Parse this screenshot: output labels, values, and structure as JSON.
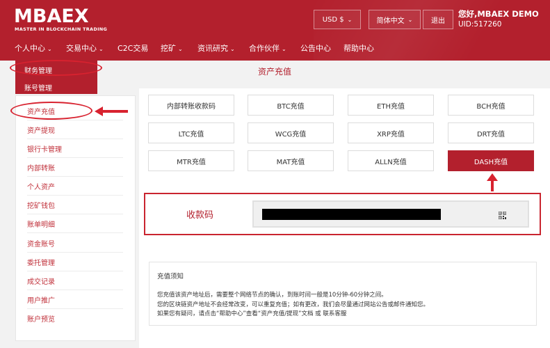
{
  "header": {
    "logo": "MBAEX",
    "logo_tagline": "MASTER IN BLOCKCHAIN TRADING",
    "currency": "USD $",
    "language": "简体中文",
    "logout": "退出",
    "greeting": "您好,MBAEX DEMO",
    "uid": "UID:517260"
  },
  "nav": {
    "items": [
      {
        "label": "个人中心",
        "has_dropdown": true
      },
      {
        "label": "交易中心",
        "has_dropdown": true
      },
      {
        "label": "C2C交易",
        "has_dropdown": false
      },
      {
        "label": "挖矿",
        "has_dropdown": true
      },
      {
        "label": "资讯研究",
        "has_dropdown": true
      },
      {
        "label": "合作伙伴",
        "has_dropdown": true
      },
      {
        "label": "公告中心",
        "has_dropdown": false
      },
      {
        "label": "帮助中心",
        "has_dropdown": false
      }
    ],
    "dropdown": [
      "财务管理",
      "账号管理"
    ]
  },
  "page_title": "资产充值",
  "sidebar": {
    "items": [
      "资产充值",
      "资产提现",
      "银行卡管理",
      "内部转账",
      "个人资产",
      "挖矿钱包",
      "账单明细",
      "资金账号",
      "委托管理",
      "成交记录",
      "用户推广",
      "账户预览"
    ],
    "active": "资产充值"
  },
  "coins": {
    "buttons": [
      "内部转账收款码",
      "BTC充值",
      "ETH充值",
      "BCH充值",
      "LTC充值",
      "WCG充值",
      "XRP充值",
      "DRT充值",
      "MTR充值",
      "MAT充值",
      "ALLN充值",
      "DASH充值"
    ],
    "active": "DASH充值"
  },
  "address": {
    "label": "收款码",
    "icon": "qr-code-icon"
  },
  "notice": {
    "title": "充值须知",
    "lines": [
      "您充值该资产地址后，需要整个网络节点的确认，到账时间一般是10分钟-60分钟之间。",
      "您的区块链资产地址不会经常改变，可以重复充值；如有更改，我们会尽量通过网站公告或邮件通知您。",
      "如果您有疑问，请点击“帮助中心”查看“资产充值/提现”文档 或 联系客服"
    ]
  },
  "colors": {
    "brand": "#b3202d",
    "annotation": "#d8222f"
  }
}
